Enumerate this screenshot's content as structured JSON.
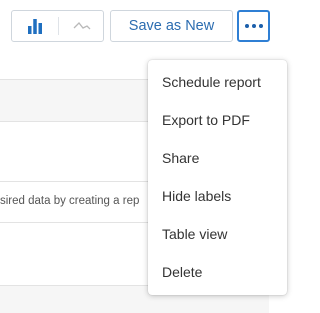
{
  "toolbar": {
    "chart_icons": [
      {
        "icon": "bar-chart-icon",
        "active": true,
        "color": "#1f6fc0"
      },
      {
        "icon": "line-chart-icon",
        "active": false,
        "color": "#b9b9b9"
      }
    ],
    "save_label": "Save as New",
    "more_icon": "more-horizontal-icon",
    "accent_color": "#2f7fd4"
  },
  "menu": {
    "items": [
      {
        "label": "Schedule report"
      },
      {
        "label": "Export to PDF"
      },
      {
        "label": "Share"
      },
      {
        "label": "Hide labels"
      },
      {
        "label": "Table view"
      },
      {
        "label": "Delete"
      }
    ]
  },
  "page": {
    "partial_text": "sired data by creating a rep"
  }
}
